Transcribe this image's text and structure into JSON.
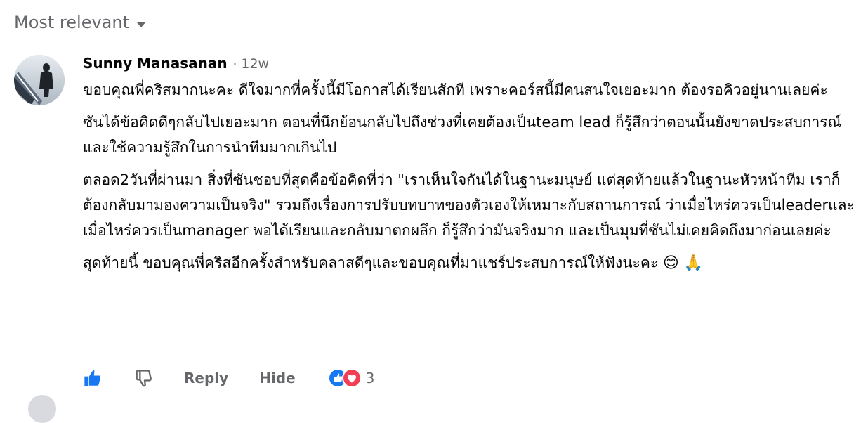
{
  "sort": {
    "label": "Most relevant",
    "icon": "caret-down-icon"
  },
  "comment": {
    "author": "Sunny Manasanan",
    "separator": "·",
    "time": "12w",
    "paragraphs": [
      "ขอบคุณพี่คริสมากนะคะ ดีใจมากที่ครั้งนี้มีโอกาสได้เรียนสักที เพราะคอร์สนี้มีคนสนใจเยอะมาก ต้องรอคิวอยู่นานเลยค่ะ",
      "ซันได้ข้อคิดดีๆกลับไปเยอะมาก ตอนที่นึกย้อนกลับไปถึงช่วงที่เคยต้องเป็นteam lead ก็รู้สึกว่าตอนนั้นยังขาดประสบการณ์ และใช้ความรู้สึกในการนำทีมมากเกินไป",
      "ตลอด2วันที่ผ่านมา สิ่งที่ซันชอบที่สุดคือข้อคิดที่ว่า \"เราเห็นใจกันได้ในฐานะมนุษย์ แต่สุดท้ายแล้วในฐานะหัวหน้าทีม เราก็ต้องกลับมามองความเป็นจริง\" รวมถึงเรื่องการปรับบทบาทของตัวเองให้เหมาะกับสถานการณ์ ว่าเมื่อไหร่ควรเป็นleaderและเมื่อไหร่ควรเป็นmanager พอได้เรียนและกลับมาตกผลึก ก็รู้สึกว่ามันจริงมาก และเป็นมุมที่ซันไม่เคยคิดถึงมาก่อนเลยค่ะ",
      "สุดท้ายนี้ ขอบคุณพี่คริสอีกครั้งสำหรับคลาสดีๆและขอบคุณที่มาแชร์ประสบการณ์ให้ฟังนะคะ"
    ],
    "closing_emojis": [
      "😊",
      "🙏"
    ]
  },
  "actions": {
    "like_icon": "thumbs-up-icon",
    "dislike_icon": "thumbs-down-icon",
    "reply_label": "Reply",
    "hide_label": "Hide",
    "reaction_icons": [
      "like-reaction-icon",
      "love-reaction-icon"
    ],
    "reaction_count": "3"
  },
  "colors": {
    "secondary_text": "#65676b",
    "primary_text": "#050505",
    "like_blue": "#1877f2",
    "love_red": "#f33e58"
  }
}
